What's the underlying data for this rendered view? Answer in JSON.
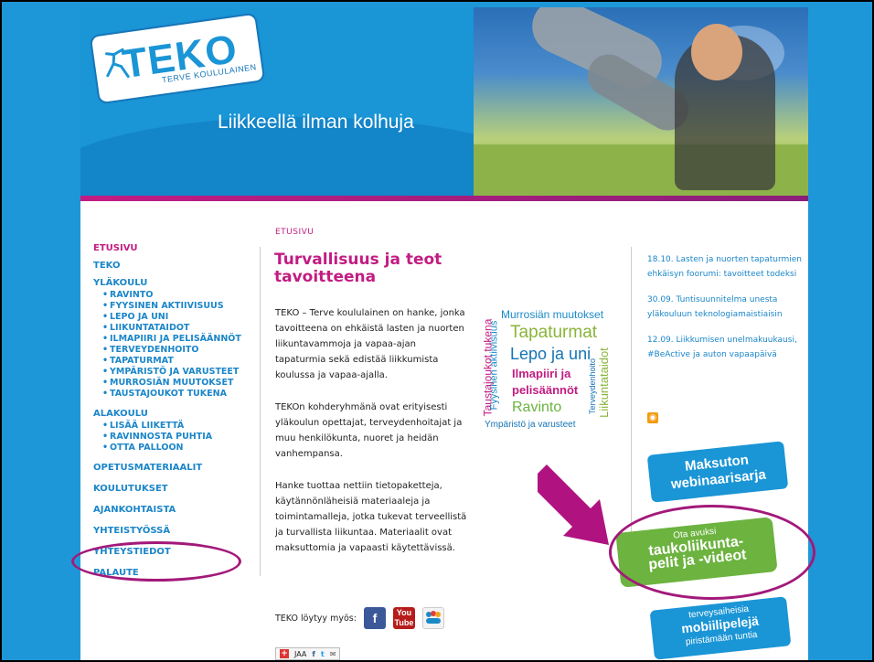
{
  "header": {
    "logo_text": "TEKO",
    "logo_sub": "TERVE KOULULAINEN",
    "slogan": "Liikkeellä ilman kolhuja"
  },
  "nav": {
    "etusivu": "ETUSIVU",
    "teko": "TEKO",
    "ylakoulu": "YLÄKOULU",
    "ylakoulu_items": [
      "RAVINTO",
      "FYYSINEN AKTIIVISUUS",
      "LEPO JA UNI",
      "LIIKUNTATAIDOT",
      "ILMAPIIRI JA PELISÄÄNNÖT",
      "TERVEYDENHOITO",
      "TAPATURMAT",
      "YMPÄRISTÖ JA VARUSTEET",
      "MURROSIÄN MUUTOKSET",
      "TAUSTAJOUKOT TUKENA"
    ],
    "alakoulu": "ALAKOULU",
    "alakoulu_items": [
      "LISÄÄ LIIKETTÄ",
      "RAVINNOSTA PUHTIA",
      "OTTA PALLOON"
    ],
    "opetusmateriaalit": "OPETUSMATERIAALIT",
    "koulutukset": "KOULUTUKSET",
    "ajankohtaista": "AJANKOHTAISTA",
    "yhteistyossa": "YHTEISTYÖSSÄ",
    "yhteystiedot": "YHTEYSTIEDOT",
    "palaute": "PALAUTE"
  },
  "main": {
    "breadcrumb": "ETUSIVU",
    "title": "Turvallisuus ja teot tavoitteena",
    "paragraphs": [
      "TEKO – Terve koululainen on hanke, jonka tavoitteena on ehkäistä lasten ja nuorten liikuntavammoja ja vapaa-ajan tapaturmia sekä edistää liikkumista koulussa ja vapaa-ajalla.",
      "TEKOn kohderyhmänä ovat erityisesti yläkoulun opettajat, terveydenhoitajat ja muu henkilökunta, nuoret ja heidän vanhempansa.",
      "Hanke tuottaa nettiin tietopaketteja, käytännönläheisiä materiaaleja ja toimintamalleja, jotka tukevat terveellistä ja turvallista liikuntaa. Materiaalit ovat maksuttomia ja vapaasti käytettävissä."
    ],
    "social_label": "TEKO löytyy myös:",
    "social_icons": [
      "f",
      "You Tube"
    ],
    "share_label": "JAA"
  },
  "cloud": {
    "words": [
      "Murrosiän muutokset",
      "Tapaturmat",
      "Lepo ja uni",
      "Ilmapiiri ja",
      "pelisäännöt",
      "Ravinto",
      "Ympäristö ja varusteet",
      "Taustajoukot tukena",
      "Fyysinen aktiivisuus",
      "Terveydenhoito",
      "Liikuntataidot"
    ]
  },
  "news": {
    "items": [
      "18.10. Lasten ja nuorten tapaturmien ehkäisyn foorumi: tavoitteet todeksi",
      "30.09. Tuntisuunnitelma unesta yläkouluun teknologiamaistiaisin",
      "12.09. Liikkumisen unelmakuukausi, #BeActive ja auton vapaapäivä"
    ]
  },
  "badges": {
    "b1_line1": "Maksuton",
    "b1_line2": "webinaarisarja",
    "b2_small": "Ota avuksi",
    "b2_line1": "taukoliikunta-",
    "b2_line2": "pelit ja -videot",
    "b3_small": "terveysaiheisia",
    "b3_line1": "mobiilipelejä",
    "b3_line2": "piristämään tuntia"
  },
  "colors": {
    "brand_blue": "#1a95d6",
    "accent_magenta": "#c21c82",
    "green": "#6cb33f"
  }
}
